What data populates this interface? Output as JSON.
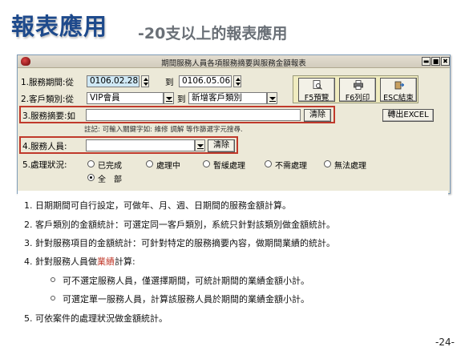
{
  "slide": {
    "title": "報表應用",
    "subtitle": "-20支以上的報表應用",
    "page_number": "-24-"
  },
  "window": {
    "title": "期間服務人員各項服務摘要與服務金額報表",
    "buttons": {
      "minimize": "▬",
      "maximize": "■",
      "close": "✖"
    }
  },
  "form": {
    "period": {
      "label": "1.服務期間:從",
      "from_value": "0106.02.28",
      "to_label": "到",
      "to_value": "0106.05.06"
    },
    "customer": {
      "label": "2.客戶類別:從",
      "from_value": "VIP會員",
      "to_label": "到",
      "to_value": "新增客戶類別"
    },
    "summary": {
      "label": "3.服務摘要:如",
      "value": "",
      "clear_label": "清除",
      "hint": "註記: 可輸入關鍵字如: 維修 調解 等作篩選字元搜尋."
    },
    "staff": {
      "label": "4.服務人員:",
      "value": "",
      "clear_label": "清除"
    },
    "status": {
      "label": "5.處理狀況:",
      "options": [
        "已完成",
        "處理中",
        "暫緩處理",
        "不需處理",
        "無法處理",
        "全　部"
      ],
      "selected": "全　部"
    }
  },
  "actions": {
    "preview": "F5預覽",
    "print": "F6列印",
    "exit": "ESC結束",
    "export": "轉出EXCEL"
  },
  "notes": {
    "n1": "1. 日期期間可自行設定，可做年、月、週、日期間的服務金額計算。",
    "n2": "2. 客戶類別的金額統計：可選定同一客戶類別，系統只針對該類別做金額統計。",
    "n3": "3. 針對服務項目的金額統計：可針對特定的服務摘要內容，做期間業績的統計。",
    "n4a": "4. 針對服務人員做",
    "n4b": "業績",
    "n4c": "計算:",
    "n4_sub1": "可不選定服務人員，僅選擇期間，可統計期間的業績金額小計。",
    "n4_sub2": "可選定單一服務人員，計算該服務人員於期間的業績金額小計。",
    "n5": "5. 可依案件的處理狀況做金額統計。"
  },
  "colors": {
    "title_blue": "#1e4a8c",
    "highlight_red": "#c0392b",
    "field_highlight": "#cfe8f5",
    "window_bg": "#ece9d8"
  }
}
